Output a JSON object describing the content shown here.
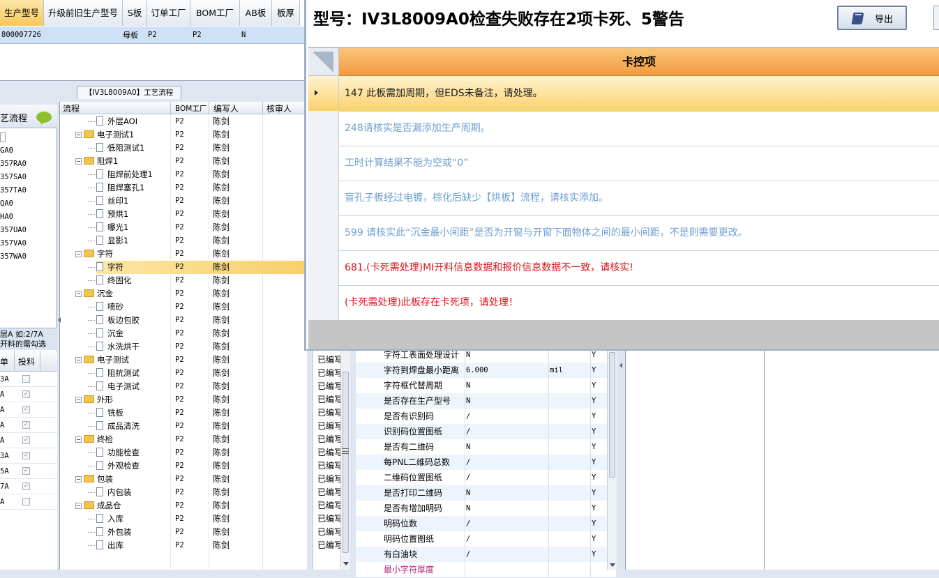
{
  "top_grid": {
    "headers": [
      "生产型号",
      "升级前旧生产型号",
      "S板",
      "订单工厂",
      "BOM工厂",
      "AB板",
      "板厚"
    ],
    "row": [
      "800007726",
      "",
      "母板",
      "P2",
      "P2",
      "N",
      ""
    ]
  },
  "left_panel": {
    "title_partial": "艺流程",
    "models": [
      "GA0",
      "357RA0",
      "357SA0",
      "357TA0",
      "QA0",
      "HA0",
      "357UA0",
      "357VA0",
      "357WA0"
    ],
    "note_line1": "层A 如:2/7A",
    "note_line2": "开料的需勾选",
    "check_headers": [
      "单",
      "投料"
    ],
    "check_rows": [
      {
        "label": "3A",
        "checked": false
      },
      {
        "label": "A",
        "checked": true
      },
      {
        "label": "A",
        "checked": true
      },
      {
        "label": "A",
        "checked": true
      },
      {
        "label": "A",
        "checked": true
      },
      {
        "label": "3A",
        "checked": true
      },
      {
        "label": "5A",
        "checked": true
      },
      {
        "label": "7A",
        "checked": true
      },
      {
        "label": "A",
        "checked": false
      }
    ]
  },
  "process_panel": {
    "tab_title": "【IV3L8009A0】工艺流程",
    "headers": [
      "流程",
      "BOM工厂",
      "编写人",
      "核审人"
    ],
    "rows": [
      {
        "name": "外层AOI",
        "folder": false,
        "level": 1,
        "bom": "P2",
        "writer": "陈剑"
      },
      {
        "name": "电子测试1",
        "folder": true,
        "level": 0,
        "bom": "P2",
        "writer": "陈剑"
      },
      {
        "name": "低阻测试1",
        "folder": false,
        "level": 1,
        "bom": "P2",
        "writer": "陈剑"
      },
      {
        "name": "阻焊1",
        "folder": true,
        "level": 0,
        "bom": "P2",
        "writer": "陈剑"
      },
      {
        "name": "阻焊前处理1",
        "folder": false,
        "level": 1,
        "bom": "P2",
        "writer": "陈剑"
      },
      {
        "name": "阻焊塞孔1",
        "folder": false,
        "level": 1,
        "bom": "P2",
        "writer": "陈剑"
      },
      {
        "name": "丝印1",
        "folder": false,
        "level": 1,
        "bom": "P2",
        "writer": "陈剑"
      },
      {
        "name": "预烘1",
        "folder": false,
        "level": 1,
        "bom": "P2",
        "writer": "陈剑"
      },
      {
        "name": "曝光1",
        "folder": false,
        "level": 1,
        "bom": "P2",
        "writer": "陈剑"
      },
      {
        "name": "显影1",
        "folder": false,
        "level": 1,
        "bom": "P2",
        "writer": "陈剑"
      },
      {
        "name": "字符",
        "folder": true,
        "level": 0,
        "bom": "P2",
        "writer": "陈剑"
      },
      {
        "name": "字符",
        "folder": false,
        "level": 1,
        "bom": "P2",
        "writer": "陈剑",
        "selected": true
      },
      {
        "name": "终固化",
        "folder": false,
        "level": 1,
        "bom": "P2",
        "writer": "陈剑"
      },
      {
        "name": "沉金",
        "folder": true,
        "level": 0,
        "bom": "P2",
        "writer": "陈剑"
      },
      {
        "name": "喷砂",
        "folder": false,
        "level": 1,
        "bom": "P2",
        "writer": "陈剑"
      },
      {
        "name": "板边包胶",
        "folder": false,
        "level": 1,
        "bom": "P2",
        "writer": "陈剑"
      },
      {
        "name": "沉金",
        "folder": false,
        "level": 1,
        "bom": "P2",
        "writer": "陈剑"
      },
      {
        "name": "水洗烘干",
        "folder": false,
        "level": 1,
        "bom": "P2",
        "writer": "陈剑"
      },
      {
        "name": "电子测试",
        "folder": true,
        "level": 0,
        "bom": "P2",
        "writer": "陈剑"
      },
      {
        "name": "阻抗测试",
        "folder": false,
        "level": 1,
        "bom": "P2",
        "writer": "陈剑"
      },
      {
        "name": "电子测试",
        "folder": false,
        "level": 1,
        "bom": "P2",
        "writer": "陈剑"
      },
      {
        "name": "外形",
        "folder": true,
        "level": 0,
        "bom": "P2",
        "writer": "陈剑"
      },
      {
        "name": "铣板",
        "folder": false,
        "level": 1,
        "bom": "P2",
        "writer": "陈剑"
      },
      {
        "name": "成品清洗",
        "folder": false,
        "level": 1,
        "bom": "P2",
        "writer": "陈剑"
      },
      {
        "name": "终检",
        "folder": true,
        "level": 0,
        "bom": "P2",
        "writer": "陈剑"
      },
      {
        "name": "功能检查",
        "folder": false,
        "level": 1,
        "bom": "P2",
        "writer": "陈剑"
      },
      {
        "name": "外观检查",
        "folder": false,
        "level": 1,
        "bom": "P2",
        "writer": "陈剑"
      },
      {
        "name": "包装",
        "folder": true,
        "level": 0,
        "bom": "P2",
        "writer": "陈剑"
      },
      {
        "name": "内包装",
        "folder": false,
        "level": 1,
        "bom": "P2",
        "writer": "陈剑"
      },
      {
        "name": "成品仓",
        "folder": true,
        "level": 0,
        "bom": "P2",
        "writer": "陈剑"
      },
      {
        "name": "入库",
        "folder": false,
        "level": 1,
        "bom": "P2",
        "writer": "陈剑"
      },
      {
        "name": "外包装",
        "folder": false,
        "level": 1,
        "bom": "P2",
        "writer": "陈剑"
      },
      {
        "name": "出库",
        "folder": false,
        "level": 1,
        "bom": "P2",
        "writer": "陈剑"
      }
    ]
  },
  "status_column": {
    "label": "已编写",
    "count": 15
  },
  "param_grid": {
    "rows": [
      {
        "name": "字符工表面处理设计",
        "value": "N",
        "unit": "",
        "flag": "Y"
      },
      {
        "name": "字符到焊盘最小距离",
        "value": "6.000",
        "unit": "mil",
        "flag": "Y"
      },
      {
        "name": "字符框代替周期",
        "value": "N",
        "unit": "",
        "flag": "Y"
      },
      {
        "name": "是否存在生产型号",
        "value": "N",
        "unit": "",
        "flag": "Y"
      },
      {
        "name": "是否有识别码",
        "value": "/",
        "unit": "",
        "flag": "Y"
      },
      {
        "name": "识别码位置图纸",
        "value": "/",
        "unit": "",
        "flag": "Y"
      },
      {
        "name": "是否有二维码",
        "value": "N",
        "unit": "",
        "flag": "Y"
      },
      {
        "name": "每PNL二维码总数",
        "value": "/",
        "unit": "",
        "flag": "Y"
      },
      {
        "name": "二维码位置图纸",
        "value": "/",
        "unit": "",
        "flag": "Y"
      },
      {
        "name": "是否打印二维码",
        "value": "N",
        "unit": "",
        "flag": "Y"
      },
      {
        "name": "是否有增加明码",
        "value": "N",
        "unit": "",
        "flag": "Y"
      },
      {
        "name": "明码位数",
        "value": "/",
        "unit": "",
        "flag": "Y"
      },
      {
        "name": "明码位置图纸",
        "value": "/",
        "unit": "",
        "flag": "Y"
      },
      {
        "name": "有白油块",
        "value": "/",
        "unit": "",
        "flag": "Y"
      },
      {
        "name": "最小字符厚度",
        "value": "",
        "unit": "",
        "flag": ""
      }
    ]
  },
  "dialog": {
    "title": "型号：IV3L8009A0检查失败存在2项卡死、5警告",
    "export_label": "导出",
    "column_header": "卡控项",
    "colors": {
      "warning": "#6f9fd0",
      "fatal": "#d9141a",
      "normal": "#1a1a1a",
      "header": "#f4a34a"
    },
    "items": [
      {
        "text": "147 此板需加周期，但EDS未备注，请处理。",
        "level": "selected"
      },
      {
        "text": "248请核实是否漏添加生产周期。",
        "level": "warning"
      },
      {
        "text": "工时计算结果不能为空或“0”",
        "level": "warning"
      },
      {
        "text": "盲孔子板经过电镀，棕化后缺少【烘板】流程，请核实添加。",
        "level": "warning"
      },
      {
        "text": "599 请核实此“沉金最小间距”是否为开窗与开窗下面物体之间的最小间距，不是则需要更改。",
        "level": "warning"
      },
      {
        "text": "681.(卡死需处理)MI开料信息数据和报价信息数据不一致，请核实!",
        "level": "fatal"
      },
      {
        "text": "(卡死需处理)此板存在卡死项，请处理！",
        "level": "fatal"
      }
    ]
  }
}
